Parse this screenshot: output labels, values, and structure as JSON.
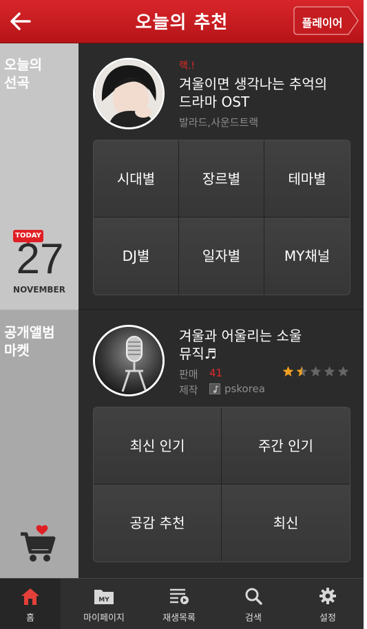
{
  "header": {
    "title": "오늘의 추천",
    "player_label": "플레이어"
  },
  "sidebar": {
    "top_label_line1": "오늘의",
    "top_label_line2": "선곡",
    "today_badge": "TODAY",
    "day": "27",
    "month": "NOVEMBER",
    "bottom_label_line1": "공개앨범",
    "bottom_label_line2": "마켓"
  },
  "pick": {
    "tag": "랙.!",
    "title_line1": "겨울이면 생각나는 추억의",
    "title_line2": "드라마 OST",
    "genres": "발라드,사운드트랙"
  },
  "pick_grid": [
    "시대별",
    "장르별",
    "테마별",
    "DJ별",
    "일자별",
    "MY채널"
  ],
  "album": {
    "title_line1": "겨울과 어울리는 소울",
    "title_line2": "뮤직♬",
    "sales_label": "판매",
    "sales_count": "41",
    "maker_label": "제작",
    "maker_name": "pskorea",
    "rating": 1.5,
    "rating_max": 5
  },
  "album_grid": [
    "최신 인기",
    "주간 인기",
    "공감 추천",
    "최신"
  ],
  "nav": [
    {
      "label": "홈",
      "icon": "home-icon",
      "active": true
    },
    {
      "label": "마이페이지",
      "icon": "my-folder-icon",
      "active": false
    },
    {
      "label": "재생목록",
      "icon": "playlist-icon",
      "active": false
    },
    {
      "label": "검색",
      "icon": "search-icon",
      "active": false
    },
    {
      "label": "설정",
      "icon": "gear-icon",
      "active": false
    }
  ],
  "colors": {
    "brand_red": "#d8262b",
    "star": "#f0a020",
    "accent_text": "#e02a2a"
  }
}
